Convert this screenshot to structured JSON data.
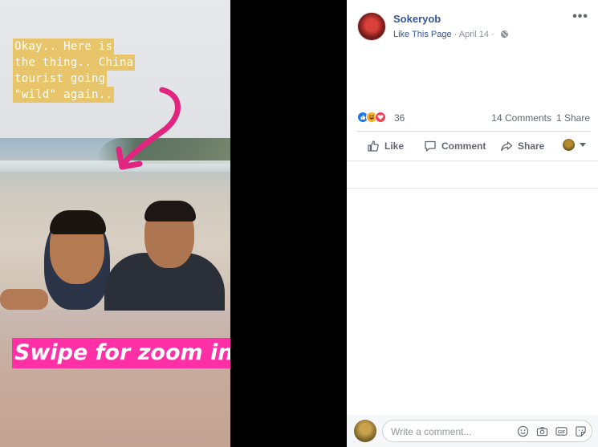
{
  "story": {
    "caption_lines": [
      "Okay.. Here is",
      "the thing.. China",
      "tourist going",
      "\"wild\" again.."
    ],
    "zoom_label": "Swipe for zoom in",
    "colors": {
      "caption_bg": "#e8c56a",
      "label_bg": "#ff2fa6",
      "arrow": "#e0247f"
    }
  },
  "post": {
    "page_name": "Sokeryob",
    "like_page": "Like This Page",
    "separator": " · ",
    "date": "April 14",
    "separator2": " · ",
    "more": "•••",
    "reaction_icons": [
      "like-reaction-icon",
      "haha-reaction-icon",
      "love-reaction-icon"
    ],
    "reaction_count": "36",
    "comments": "14 Comments",
    "shares": "1 Share",
    "actions": {
      "like": "Like",
      "comment": "Comment",
      "share": "Share"
    }
  },
  "comment_box": {
    "placeholder": "Write a comment...",
    "icons": [
      "emoji-icon",
      "camera-icon",
      "gif-icon",
      "sticker-icon"
    ]
  }
}
